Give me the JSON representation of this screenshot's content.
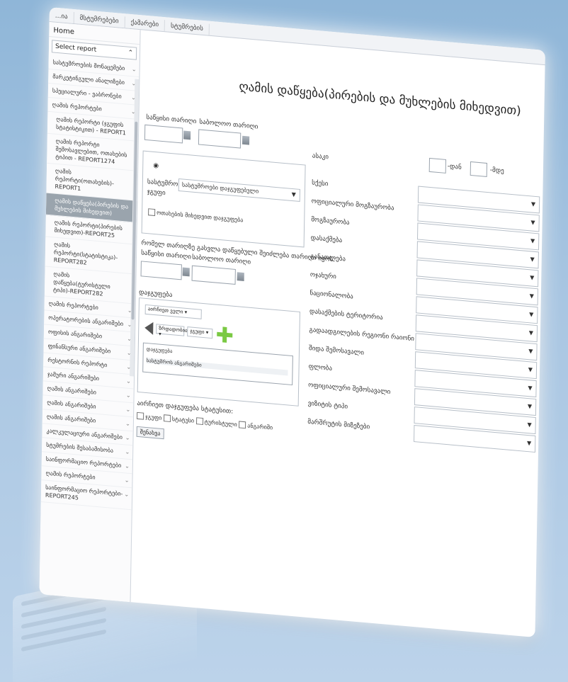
{
  "tabs": [
    "...ია",
    "მსტუმრებები",
    "ქამარები",
    "სტუმრების"
  ],
  "sidebar": {
    "home": "Home",
    "select_placeholder": "Select report",
    "items": [
      {
        "label": "სასტუმროების მონაცემები",
        "level": 0
      },
      {
        "label": "მარკეტინგული ანალიზები",
        "level": 0
      },
      {
        "label": "სპეციალური - ვაბრონები",
        "level": 0
      },
      {
        "label": "ღამის რეპორტები",
        "level": 0
      },
      {
        "label": "ღამის რეპორტი (ჯგუფის სტატისტიკით) - REPORT1",
        "level": 1
      },
      {
        "label": "ღამის რეპორტი შემოსავლებით, ოთახების ტიპით - REPORT1274",
        "level": 1
      },
      {
        "label": "ღამის რეპორტი(ოთახების)-REPORT1",
        "level": 1
      },
      {
        "label": "ღამის დაწყება(პირების და მუხლების მიხედვით)",
        "level": 1,
        "active": true
      },
      {
        "label": "ღამის რეპორტი(პირების მიხედვით)-REPORT25",
        "level": 1
      },
      {
        "label": "ღამის რეპორტი(სტატისტიკა)-REPORT282",
        "level": 1
      },
      {
        "label": "ღამის დაწყება(ტურისტული ტიპი)-REPORT282",
        "level": 1
      },
      {
        "label": "ღამის რეპორტები",
        "level": 0
      },
      {
        "label": "ოპერატორების ანგარიშები",
        "level": 0
      },
      {
        "label": "ოფისის ანგარიშები",
        "level": 0
      },
      {
        "label": "ფინანსური ანგარიშები",
        "level": 0
      },
      {
        "label": "რესტორნის რეპორტი",
        "level": 0
      },
      {
        "label": "ჯამური ანგარიშები",
        "level": 0
      },
      {
        "label": "ღამის ანგარიშები",
        "level": 0
      },
      {
        "label": "ღამის ანგარიშები",
        "level": 0
      },
      {
        "label": "ღამის ანგარიშები",
        "level": 0
      },
      {
        "label": "კალკულაციური ანგარიშები",
        "level": 0
      },
      {
        "label": "სტუმრების შესაბამისობა",
        "level": 0
      },
      {
        "label": "საინფორმაციო რეპორტები",
        "level": 0
      },
      {
        "label": "ღამის რეპორტები",
        "level": 0
      },
      {
        "label": "საინფორმაციო რეპორტები-REPORT245",
        "level": 0
      }
    ]
  },
  "main": {
    "title": "ღამის დაწყება(პირების და მუხლების მიხედვით)",
    "start_date_label": "საწყისი თარიღი",
    "end_date_label": "საბოლოო თარიღი",
    "start_date_label_2": "საწყისი თარიღი",
    "end_date_label_2": "საბოლოო თარიღი",
    "hotel_label": "სასტუმროები",
    "hotel_group_label": "ჯგუფი",
    "hotel_dropdown_value": "სასტუმროები დაჯგუფებული",
    "hotel_checkbox_label": "ოთახების მიხედვით დაჯგუფება",
    "question_line": "რომელ თარიღზე გასვლა დაწყებული შეიძლება თარიღი იყოს:",
    "grouping_label": "დაჯგუფება",
    "grouping_dropdown": "აირჩიეთ ველი",
    "sort_dd_1": "ზრდადობით",
    "sort_dd_2": "ჯგუფი",
    "list_header": "დაჯგუფება",
    "list_item": "სასტუმროს ანგარიშები",
    "show_label": "აირჩიეთ დაჯგუფება სტატუსით:",
    "checkbox_1": "ჯგუფი",
    "checkbox_2": "სტატუსი",
    "checkbox_3": "ტურისტული",
    "checkbox_4": "ანგარიში",
    "generate_button": "შენახვა",
    "age_label": "ასაკი",
    "from_label": "-დან",
    "to_label": "-მდე",
    "right_fields": [
      "სქესი",
      "ოფიციალური მოგზაურობა",
      "მოგზაურობა",
      "დასაქმება",
      "განათლება",
      "ოჯახური",
      "ნაციონალობა",
      "დასაქმების ტერიტორია",
      "გადაადგილების რეგიონი რაიონი",
      "შიდა შემოსავალი",
      "ფლობა",
      "ოფიციალური შემოსავალი",
      "ვიზიტის ტიპი",
      "მარშრუტის მიზეზები"
    ]
  },
  "colors": {
    "accent_plus": "#7ac943",
    "active_item": "#9aa4ad"
  }
}
